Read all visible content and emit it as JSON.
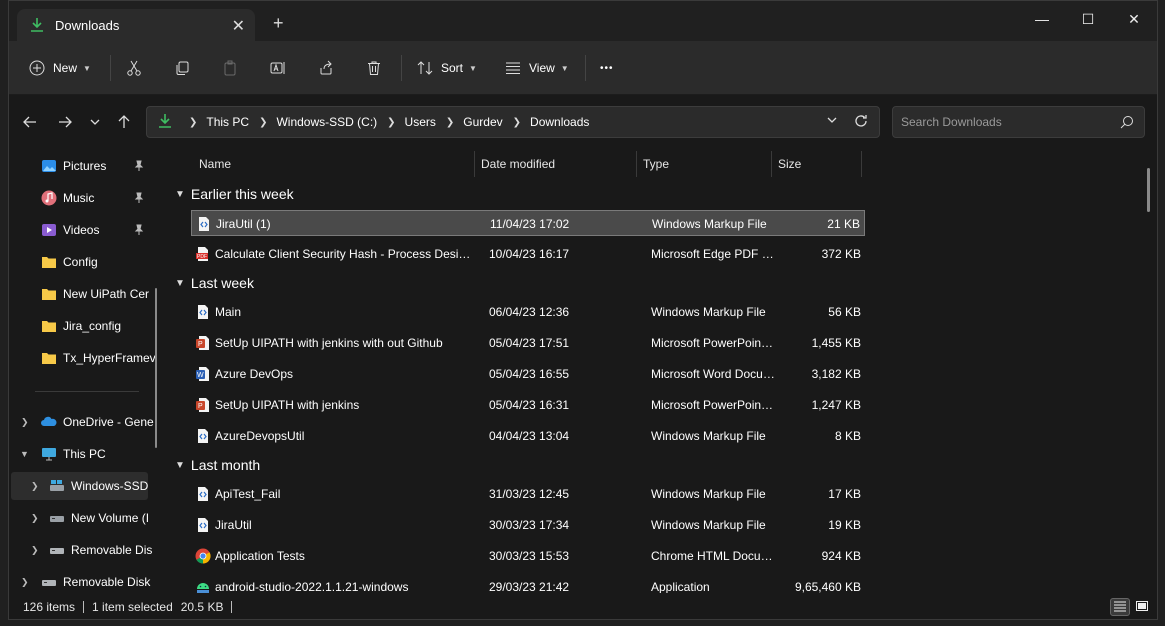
{
  "window": {
    "tab_title": "Downloads",
    "tab_close": "✕",
    "new_tab": "+",
    "minimize": "—",
    "maximize": "☐",
    "close": "✕"
  },
  "toolbar": {
    "new_label": "New",
    "sort_label": "Sort",
    "view_label": "View",
    "more": "•••"
  },
  "address": {
    "crumbs": [
      "This PC",
      "Windows-SSD (C:)",
      "Users",
      "Gurdev",
      "Downloads"
    ]
  },
  "search": {
    "placeholder": "Search Downloads"
  },
  "sidebar": {
    "items": [
      {
        "label": "Pictures",
        "icon": "pictures-icon",
        "pinned": true
      },
      {
        "label": "Music",
        "icon": "music-icon",
        "pinned": true
      },
      {
        "label": "Videos",
        "icon": "videos-icon",
        "pinned": true
      },
      {
        "label": "Config",
        "icon": "folder-icon"
      },
      {
        "label": "New UiPath Cer",
        "icon": "folder-icon"
      },
      {
        "label": "Jira_config",
        "icon": "folder-icon"
      },
      {
        "label": "Tx_HyperFramev",
        "icon": "folder-icon"
      },
      {
        "label": "OneDrive - Gene",
        "icon": "onedrive-icon"
      },
      {
        "label": "This PC",
        "icon": "pc-icon"
      },
      {
        "label": "Windows-SSD",
        "icon": "drive-icon"
      },
      {
        "label": "New Volume (I",
        "icon": "drive-icon"
      },
      {
        "label": "Removable Dis",
        "icon": "usb-drive-icon"
      },
      {
        "label": "Removable Disk",
        "icon": "usb-drive-icon"
      }
    ]
  },
  "columns": {
    "name": "Name",
    "date": "Date modified",
    "type": "Type",
    "size": "Size"
  },
  "groups": [
    {
      "title": "Earlier this week"
    },
    {
      "title": "Last week"
    },
    {
      "title": "Last month"
    }
  ],
  "files": [
    {
      "name": "JiraUtil (1)",
      "date": "11/04/23 17:02",
      "type": "Windows Markup File",
      "size": "21 KB",
      "icon": "xaml-file-icon"
    },
    {
      "name": "Calculate Client Security Hash - Process Design Document",
      "date": "10/04/23 16:17",
      "type": "Microsoft Edge PDF Document",
      "size": "372 KB",
      "icon": "pdf-file-icon"
    },
    {
      "name": "Main",
      "date": "06/04/23 12:36",
      "type": "Windows Markup File",
      "size": "56 KB",
      "icon": "xaml-file-icon"
    },
    {
      "name": "SetUp UIPATH with jenkins with out Github",
      "date": "05/04/23 17:51",
      "type": "Microsoft PowerPoint Presentation",
      "size": "1,455 KB",
      "icon": "powerpoint-file-icon"
    },
    {
      "name": "Azure DevOps",
      "date": "05/04/23 16:55",
      "type": "Microsoft Word Document",
      "size": "3,182 KB",
      "icon": "word-file-icon"
    },
    {
      "name": "SetUp UIPATH with jenkins",
      "date": "05/04/23 16:31",
      "type": "Microsoft PowerPoint Presentation",
      "size": "1,247 KB",
      "icon": "powerpoint-file-icon"
    },
    {
      "name": "AzureDevopsUtil",
      "date": "04/04/23 13:04",
      "type": "Windows Markup File",
      "size": "8 KB",
      "icon": "xaml-file-icon"
    },
    {
      "name": "ApiTest_Fail",
      "date": "31/03/23 12:45",
      "type": "Windows Markup File",
      "size": "17 KB",
      "icon": "xaml-file-icon"
    },
    {
      "name": "JiraUtil",
      "date": "30/03/23 17:34",
      "type": "Windows Markup File",
      "size": "19 KB",
      "icon": "xaml-file-icon"
    },
    {
      "name": "Application Tests",
      "date": "30/03/23 15:53",
      "type": "Chrome HTML Document",
      "size": "924 KB",
      "icon": "chrome-file-icon"
    },
    {
      "name": "android-studio-2022.1.1.21-windows",
      "date": "29/03/23 21:42",
      "type": "Application",
      "size": "9,65,460 KB",
      "icon": "android-studio-icon"
    }
  ],
  "status": {
    "item_count": "126 items",
    "selection": "1 item selected",
    "selection_size": "20.5 KB"
  },
  "colors": {
    "accent_green": "#3fbd62",
    "folder_yellow": "#f7c948",
    "selection_bg": "#4a4a4a"
  }
}
